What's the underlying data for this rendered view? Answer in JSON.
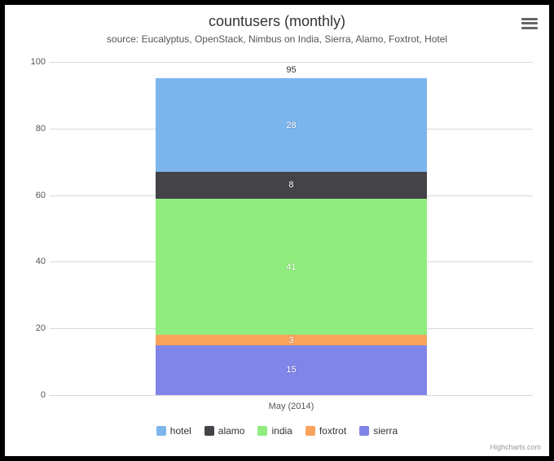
{
  "chart_data": {
    "type": "bar",
    "stacked": true,
    "title": "countusers (monthly)",
    "subtitle": "source: Eucalyptus, OpenStack, Nimbus on India, Sierra, Alamo, Foxtrot, Hotel",
    "categories": [
      "May (2014)"
    ],
    "series": [
      {
        "name": "hotel",
        "color": "#7cb5ec",
        "values": [
          28
        ]
      },
      {
        "name": "alamo",
        "color": "#434348",
        "values": [
          8
        ]
      },
      {
        "name": "india",
        "color": "#90ed7d",
        "values": [
          41
        ]
      },
      {
        "name": "foxtrot",
        "color": "#f7a35c",
        "values": [
          3
        ]
      },
      {
        "name": "sierra",
        "color": "#8085e9",
        "values": [
          15
        ]
      }
    ],
    "stack_totals": [
      95
    ],
    "ylim": [
      0,
      100
    ],
    "y_ticks": [
      0,
      20,
      40,
      60,
      80,
      100
    ],
    "xlabel": "",
    "ylabel": ""
  },
  "credit": "Highcharts.com"
}
